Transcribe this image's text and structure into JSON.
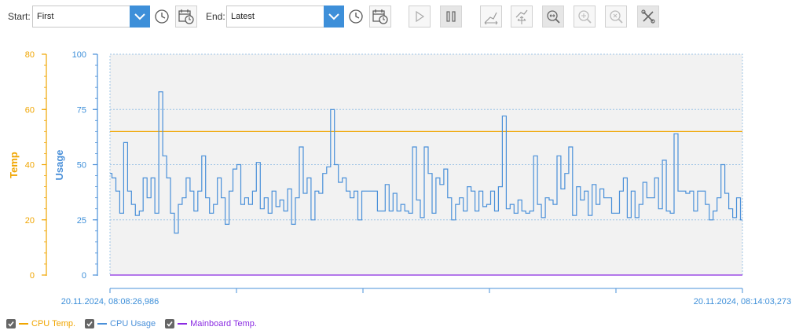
{
  "toolbar": {
    "start_label": "Start:",
    "start_value": "First",
    "end_label": "End:",
    "end_value": "Latest",
    "icons": [
      "chevron-down-icon",
      "clock-icon",
      "calendar-clock-icon",
      "play-icon",
      "pause-icon",
      "pan-horizontal-icon",
      "pan-all-icon",
      "zoom-fit-icon",
      "zoom-in-icon",
      "zoom-reset-icon",
      "tools-icon"
    ]
  },
  "colors": {
    "temp_axis": "#f0a500",
    "usage_axis": "#3d8fd9",
    "cpu_temp": "#f0a500",
    "cpu_usage": "#4a90d9",
    "mainboard_temp": "#8a2be2",
    "accent": "#3d8fd9"
  },
  "chart_data": {
    "type": "line",
    "y_left": {
      "label": "Temp",
      "min": 0,
      "max": 80,
      "ticks": [
        0,
        20,
        40,
        60,
        80
      ]
    },
    "y_right": {
      "label": "Usage",
      "min": 0,
      "max": 100,
      "ticks": [
        0,
        25,
        50,
        75,
        100
      ]
    },
    "x_start_label": "20.11.2024, 08:08:26,986",
    "x_end_label": "20.11.2024, 08:14:03,273",
    "grid": true,
    "series": [
      {
        "name": "CPU Temp.",
        "axis": "temp",
        "constant": 52
      },
      {
        "name": "CPU Usage",
        "axis": "usage",
        "values": [
          46,
          44,
          38,
          28,
          60,
          38,
          32,
          27,
          29,
          44,
          35,
          44,
          28,
          83,
          54,
          44,
          28,
          19,
          32,
          35,
          44,
          38,
          29,
          38,
          54,
          35,
          28,
          32,
          44,
          35,
          23,
          38,
          48,
          50,
          32,
          35,
          32,
          38,
          51,
          30,
          35,
          28,
          38,
          31,
          34,
          29,
          39,
          23,
          35,
          58,
          37,
          44,
          25,
          38,
          37,
          46,
          49,
          75,
          50,
          42,
          44,
          38,
          35,
          38,
          25,
          38,
          38,
          38,
          38,
          29,
          29,
          41,
          29,
          37,
          29,
          32,
          29,
          28,
          58,
          34,
          26,
          58,
          46,
          28,
          44,
          41,
          48,
          35,
          25,
          32,
          35,
          29,
          40,
          38,
          29,
          38,
          31,
          32,
          38,
          29,
          40,
          72,
          30,
          32,
          28,
          34,
          29,
          28,
          29,
          54,
          32,
          26,
          35,
          34,
          32,
          54,
          39,
          46,
          58,
          27,
          40,
          34,
          38,
          27,
          41,
          32,
          39,
          35,
          35,
          28,
          28,
          38,
          44,
          26,
          38,
          26,
          32,
          42,
          35,
          35,
          44,
          30,
          52,
          29,
          28,
          64,
          38,
          38,
          37,
          38,
          29,
          38,
          38,
          32,
          25,
          29,
          35,
          50,
          37,
          30,
          26,
          35,
          25
        ],
        "min": 18,
        "max": 84
      },
      {
        "name": "Mainboard Temp.",
        "axis": "temp",
        "constant": 0
      }
    ]
  },
  "legend": [
    {
      "label": "CPU Temp."
    },
    {
      "label": "CPU Usage"
    },
    {
      "label": "Mainboard Temp."
    }
  ]
}
